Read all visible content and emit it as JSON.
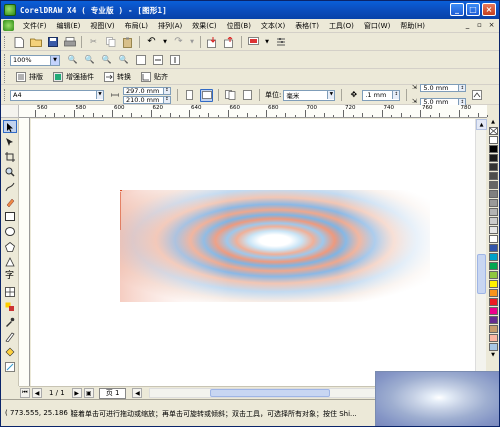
{
  "window": {
    "title": "CorelDRAW X4 ( 专业版 ) - [图形1]",
    "minimize_glyph": "_",
    "maximize_glyph": "□",
    "close_glyph": "×"
  },
  "menu": {
    "items": [
      "文件(F)",
      "编辑(E)",
      "视图(V)",
      "布局(L)",
      "排列(A)",
      "效果(C)",
      "位图(B)",
      "文本(X)",
      "表格(T)",
      "工具(O)",
      "窗口(W)",
      "帮助(H)"
    ],
    "doc_min_glyph": "_",
    "doc_restore_glyph": "▫",
    "doc_close_glyph": "×"
  },
  "standard_toolbar": {
    "icons": [
      "new-icon",
      "open-icon",
      "save-icon",
      "print-icon",
      "cut-icon",
      "copy-icon",
      "paste-icon",
      "undo-icon",
      "redo-icon",
      "import-icon",
      "export-icon",
      "app-launcher-icon",
      "options-icon"
    ]
  },
  "zoom_toolbar": {
    "zoom_level": "100%",
    "icons": [
      "zoom-in-icon",
      "zoom-out-icon",
      "zoom-selected-icon",
      "zoom-all-icon",
      "zoom-page-icon",
      "zoom-width-icon",
      "zoom-height-icon"
    ]
  },
  "effects_toolbar": {
    "buttons": [
      {
        "label": "排版",
        "icon": "layout-icon"
      },
      {
        "label": "增强插件",
        "icon": "plugin-icon"
      },
      {
        "label": "转换",
        "icon": "convert-icon"
      },
      {
        "label": "贴齐",
        "icon": "snap-icon"
      }
    ]
  },
  "property_bar": {
    "paper_size": "A4",
    "width": "297.0 mm",
    "height": "210.0 mm",
    "units_label": "单位:",
    "units": "毫米",
    "nudge": ".1 mm",
    "dup_x": "5.0 mm",
    "dup_y": "5.0 mm"
  },
  "ruler": {
    "labels": [
      "560",
      "580",
      "600",
      "620",
      "640",
      "660",
      "680",
      "700",
      "720",
      "740",
      "760",
      "780"
    ]
  },
  "page_nav": {
    "page_count": "1 / 1",
    "page_tab": "页 1"
  },
  "status": {
    "coords": "( 773.555, 25.186 )",
    "hint": "接着单击可进行拖动或缩放；再单击可旋转或倾斜；双击工具，可选择所有对象；按住 Shi..."
  },
  "palette": {
    "colors": [
      "#ffffff",
      "#000000",
      "#1a1a1a",
      "#333333",
      "#4d4d4d",
      "#666666",
      "#808080",
      "#999999",
      "#b3b3b3",
      "#cccccc",
      "#e6e6e6",
      "#ffffff",
      "#3355aa",
      "#00a0c8",
      "#00a651",
      "#8dc63f",
      "#fff200",
      "#f7941d",
      "#ed1c24",
      "#ec008c",
      "#662d91",
      "#c69c6d",
      "#f9b5a4",
      "#a7c7e7"
    ]
  }
}
